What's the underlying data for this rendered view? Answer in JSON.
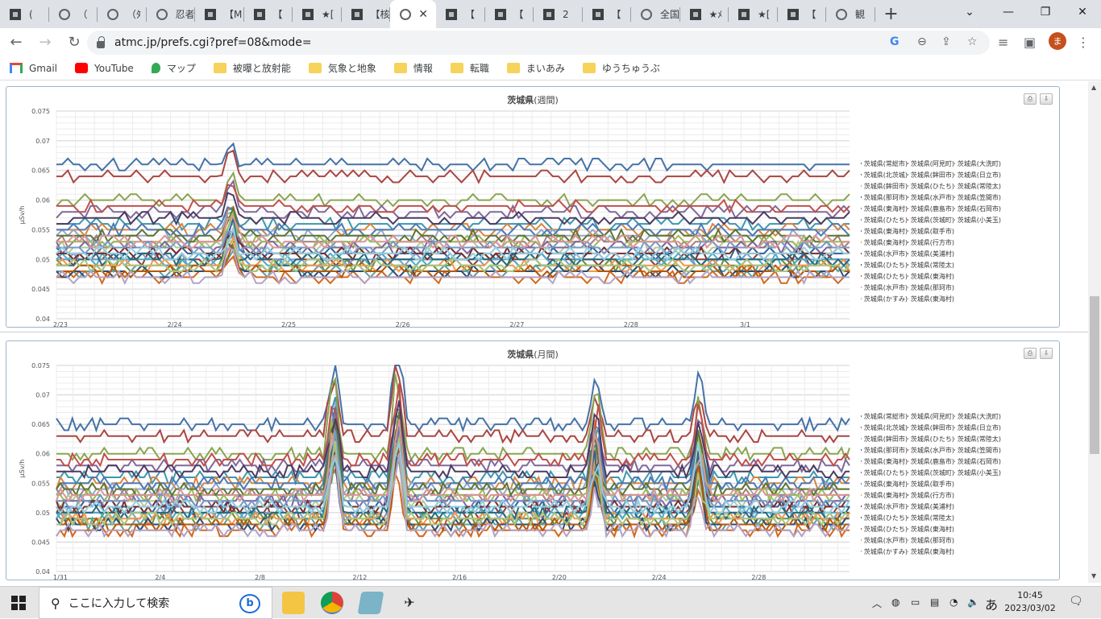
{
  "browser": {
    "tabs": [
      {
        "title": "(",
        "icon": "doc-icon"
      },
      {
        "title": "（",
        "icon": "globe-icon"
      },
      {
        "title": "（ﾀ",
        "icon": "globe-icon"
      },
      {
        "title": "忍者",
        "icon": "globe-icon"
      },
      {
        "title": "【M",
        "icon": "doc-icon"
      },
      {
        "title": "【",
        "icon": "doc-icon"
      },
      {
        "title": "★[",
        "icon": "doc-icon"
      },
      {
        "title": "【核",
        "icon": "doc-icon"
      },
      {
        "title": "",
        "icon": "globe-icon",
        "active": true
      },
      {
        "title": "【",
        "icon": "doc-icon"
      },
      {
        "title": "【",
        "icon": "doc-icon"
      },
      {
        "title": "2",
        "icon": "doc-icon"
      },
      {
        "title": "【",
        "icon": "doc-icon"
      },
      {
        "title": "全国",
        "icon": "globe-icon"
      },
      {
        "title": "★ﾒ",
        "icon": "doc-icon"
      },
      {
        "title": "★[",
        "icon": "doc-icon"
      },
      {
        "title": "【",
        "icon": "doc-icon"
      },
      {
        "title": "観",
        "icon": "globe-icon"
      }
    ],
    "url": "atmc.jp/prefs.cgi?pref=08&mode=",
    "avatar_letter": "ま",
    "bookmarks": [
      {
        "label": "Gmail",
        "icon": "gmail-icon"
      },
      {
        "label": "YouTube",
        "icon": "youtube-icon"
      },
      {
        "label": "マップ",
        "icon": "maps-icon"
      },
      {
        "label": "被曝と放射能",
        "icon": "folder-icon"
      },
      {
        "label": "気象と地象",
        "icon": "folder-icon"
      },
      {
        "label": "情報",
        "icon": "folder-icon"
      },
      {
        "label": "転職",
        "icon": "folder-icon"
      },
      {
        "label": "まいあみ",
        "icon": "folder-icon"
      },
      {
        "label": "ゆうちゅうぶ",
        "icon": "folder-icon"
      }
    ]
  },
  "legend_items": [
    "茨城県(常総市)",
    "茨城県(阿見町)",
    "茨城県(大洗町)",
    "茨城県(北茨城)",
    "茨城県(鉾田市)",
    "茨城県(日立市)",
    "茨城県(鉾田市)",
    "茨城県(ひたち)",
    "茨城県(常陸太)",
    "茨城県(那珂市)",
    "茨城県(水戸市)",
    "茨城県(笠間市)",
    "茨城県(東海村)",
    "茨城県(鹿島市)",
    "茨城県(石岡市)",
    "茨城県(ひたち)",
    "茨城県(茨城町)",
    "茨城県(小美玉)",
    "茨城県(東海村)",
    "茨城県(取手市)",
    "茨城県(東海村)",
    "茨城県(行方市)",
    "茨城県(水戸市)",
    "茨城県(美浦村)",
    "茨城県(ひたち)",
    "茨城県(常陸太)",
    "茨城県(ひたち)",
    "茨城県(東海村)",
    "茨城県(水戸市)",
    "茨城県(那珂市)",
    "茨城県(かすみ)",
    "茨城県(東海村)"
  ],
  "series_colors": [
    "#4572a7",
    "#aa4643",
    "#89a54e",
    "#80699b",
    "#3d96ae",
    "#db843d",
    "#92a8cd",
    "#a47d7c",
    "#b5ca92",
    "#2f5f98",
    "#8f3a3a",
    "#6b8e3d",
    "#5f9ea0",
    "#d2691e",
    "#7c9ec9",
    "#4a7bb7",
    "#c0504d",
    "#9bbb59",
    "#8064a2",
    "#4bacc6",
    "#f79646",
    "#2c4d75",
    "#772c2a",
    "#5f7530",
    "#4d3b62",
    "#276a7c",
    "#b65708",
    "#729aca",
    "#d99694",
    "#a9c47f",
    "#b3a2c7",
    "#93cddd"
  ],
  "charts": [
    {
      "title": "茨城県",
      "subtitle": "(週間)",
      "chart_data": {
        "type": "line",
        "ylabel": "μSv/h",
        "ylim": [
          0.04,
          0.075
        ],
        "yticks": [
          "0.075",
          "0.07",
          "0.065",
          "0.06",
          "0.055",
          "0.05",
          "0.045",
          "0.04"
        ],
        "xticks": [
          "2/23",
          "2/24",
          "2/25",
          "2/26",
          "2/27",
          "2/28",
          "3/1"
        ],
        "n_points": 140,
        "spikes": [
          {
            "at": 0.22,
            "height": 0.006
          }
        ],
        "series_levels": [
          0.066,
          0.064,
          0.06,
          0.058,
          0.056,
          0.055,
          0.054,
          0.053,
          0.052,
          0.051,
          0.05,
          0.049,
          0.048,
          0.047,
          0.05,
          0.055,
          0.059,
          0.053,
          0.052,
          0.05,
          0.049,
          0.048,
          0.051,
          0.054,
          0.057,
          0.05,
          0.048,
          0.052,
          0.053,
          0.049,
          0.047,
          0.051
        ]
      }
    },
    {
      "title": "茨城県",
      "subtitle": "(月間)",
      "chart_data": {
        "type": "line",
        "ylabel": "μSv/h",
        "ylim": [
          0.04,
          0.075
        ],
        "yticks": [
          "0.075",
          "0.07",
          "0.065",
          "0.06",
          "0.055",
          "0.05",
          "0.045",
          "0.04"
        ],
        "xticks": [
          "1/31",
          "2/4",
          "2/8",
          "2/12",
          "2/16",
          "2/20",
          "2/24",
          "2/28"
        ],
        "n_points": 200,
        "spikes": [
          {
            "at": 0.35,
            "height": 0.015
          },
          {
            "at": 0.43,
            "height": 0.018
          },
          {
            "at": 0.68,
            "height": 0.012
          },
          {
            "at": 0.81,
            "height": 0.01
          }
        ],
        "series_levels": [
          0.065,
          0.063,
          0.06,
          0.058,
          0.056,
          0.055,
          0.054,
          0.053,
          0.052,
          0.051,
          0.05,
          0.049,
          0.048,
          0.047,
          0.05,
          0.055,
          0.059,
          0.053,
          0.052,
          0.05,
          0.049,
          0.048,
          0.051,
          0.054,
          0.057,
          0.05,
          0.048,
          0.052,
          0.053,
          0.049,
          0.047,
          0.051
        ]
      }
    }
  ],
  "taskbar": {
    "search_placeholder": "ここに入力して検索",
    "time": "10:45",
    "date": "2023/03/02",
    "ime": "あ"
  }
}
